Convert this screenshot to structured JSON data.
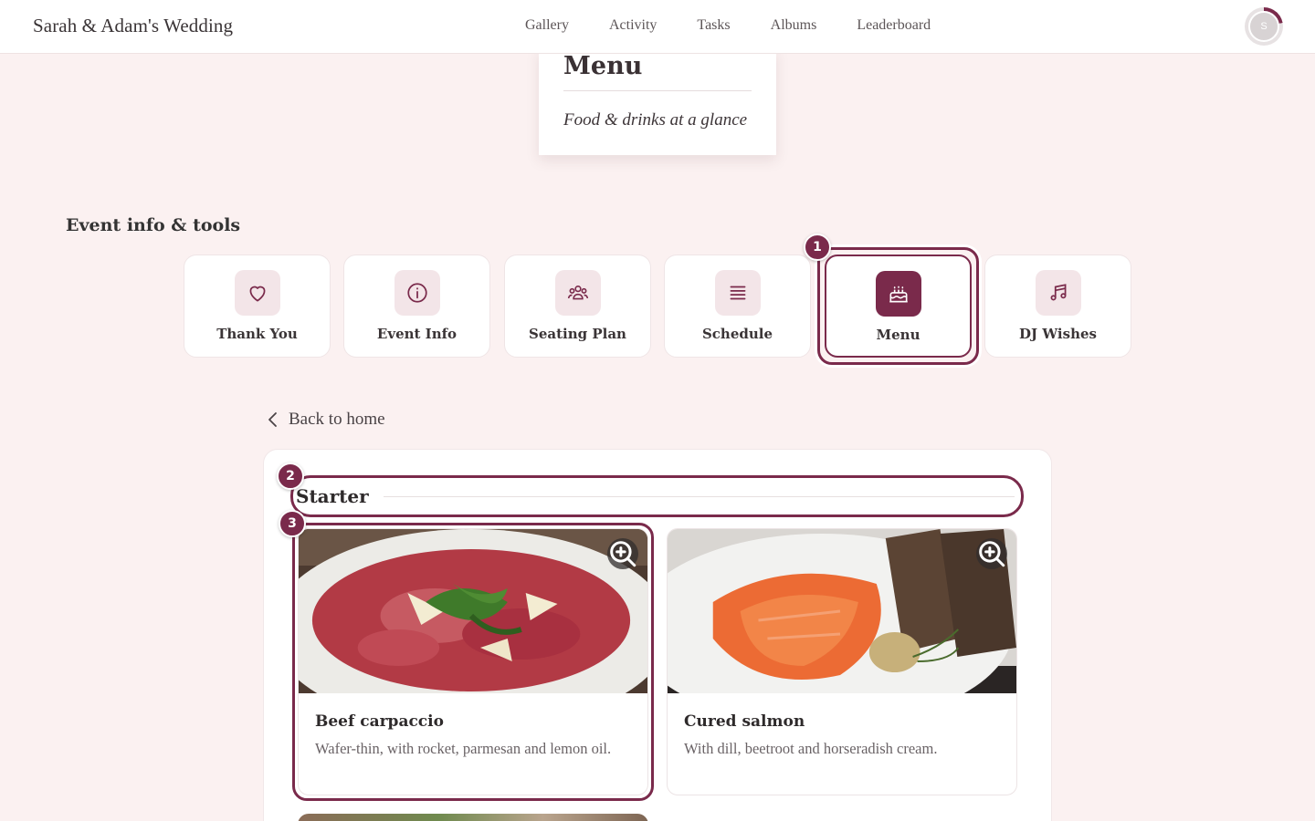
{
  "header": {
    "brand": "Sarah & Adam's Wedding",
    "nav": [
      "Gallery",
      "Activity",
      "Tasks",
      "Albums",
      "Leaderboard"
    ],
    "avatar_initial": "S"
  },
  "title_card": {
    "title": "Menu",
    "subtitle": "Food & drinks at a glance"
  },
  "tools": {
    "section_title": "Event info & tools",
    "items": [
      {
        "label": "Thank You",
        "icon": "heart-icon"
      },
      {
        "label": "Event Info",
        "icon": "info-icon"
      },
      {
        "label": "Seating Plan",
        "icon": "people-icon"
      },
      {
        "label": "Schedule",
        "icon": "list-icon"
      },
      {
        "label": "Menu",
        "icon": "cake-icon",
        "active": true
      },
      {
        "label": "DJ Wishes",
        "icon": "music-note-icon"
      }
    ]
  },
  "back_link": "Back to home",
  "menu": {
    "course": "Starter",
    "dishes": [
      {
        "name": "Beef carpaccio",
        "description": "Wafer-thin, with rocket, parmesan and lemon oil."
      },
      {
        "name": "Cured salmon",
        "description": "With dill, beetroot and horseradish cream."
      }
    ]
  },
  "annotations": [
    "1",
    "2",
    "3"
  ],
  "colors": {
    "accent": "#7a2a4b",
    "background": "#fbf1f1",
    "icon_tile": "#f3e5e8"
  }
}
